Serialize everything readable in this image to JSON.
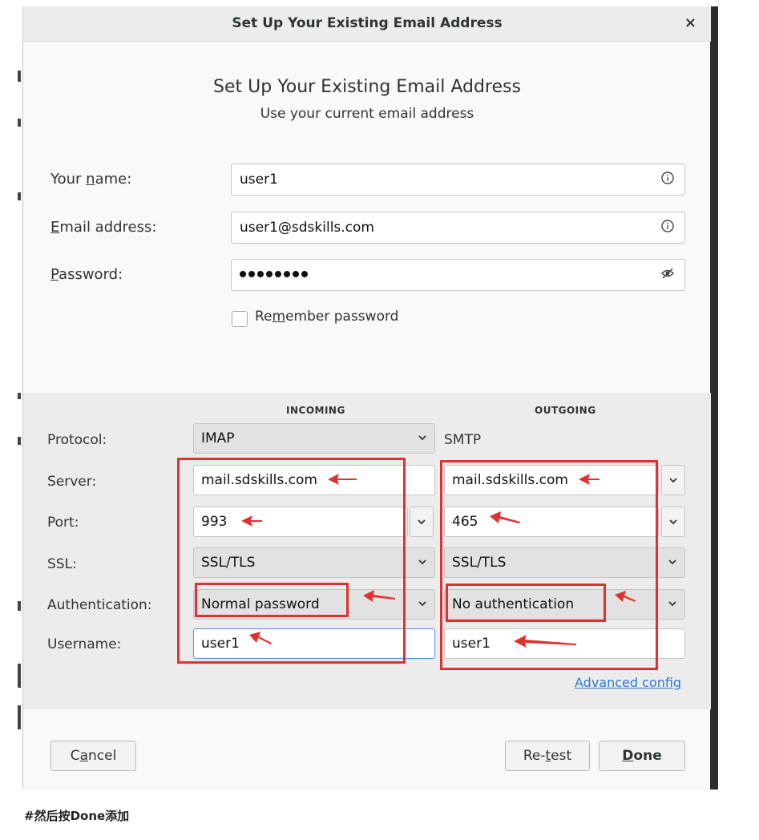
{
  "dialog": {
    "title": "Set Up Your Existing Email Address",
    "close_label": "×",
    "heading": "Set Up Your Existing Email Address",
    "subheading": "Use your current email address"
  },
  "form": {
    "name_label_pre": "Your ",
    "name_label_u": "n",
    "name_label_post": "ame:",
    "name_value": "user1",
    "email_label_u": "E",
    "email_label_post": "mail address:",
    "email_value": "user1@sdskills.com",
    "password_label_u": "P",
    "password_label_post": "assword:",
    "password_dots": 8,
    "remember_pre": "Re",
    "remember_u": "m",
    "remember_post": "ember password",
    "remember_checked": false
  },
  "server_config": {
    "incoming_header": "INCOMING",
    "outgoing_header": "OUTGOING",
    "protocol_label": "Protocol:",
    "server_label": "Server:",
    "port_label": "Port:",
    "ssl_label": "SSL:",
    "auth_label": "Authentication:",
    "username_label": "Username:",
    "incoming": {
      "protocol": "IMAP",
      "server": "mail.sdskills.com",
      "port": "993",
      "ssl": "SSL/TLS",
      "auth": "Normal password",
      "username": "user1"
    },
    "outgoing": {
      "protocol": "SMTP",
      "server": "mail.sdskills.com",
      "port": "465",
      "ssl": "SSL/TLS",
      "auth": "No authentication",
      "username": "user1"
    },
    "advanced_link_u": "A",
    "advanced_link_post": "dvanced config"
  },
  "buttons": {
    "cancel_pre": "C",
    "cancel_u": "a",
    "cancel_post": "ncel",
    "retest_pre": "Re-",
    "retest_u": "t",
    "retest_post": "est",
    "done_u": "D",
    "done_post": "one"
  },
  "caption": "#然后按Done添加",
  "colors": {
    "annotation_red": "#e03131",
    "link_blue": "#2a7ad8"
  }
}
